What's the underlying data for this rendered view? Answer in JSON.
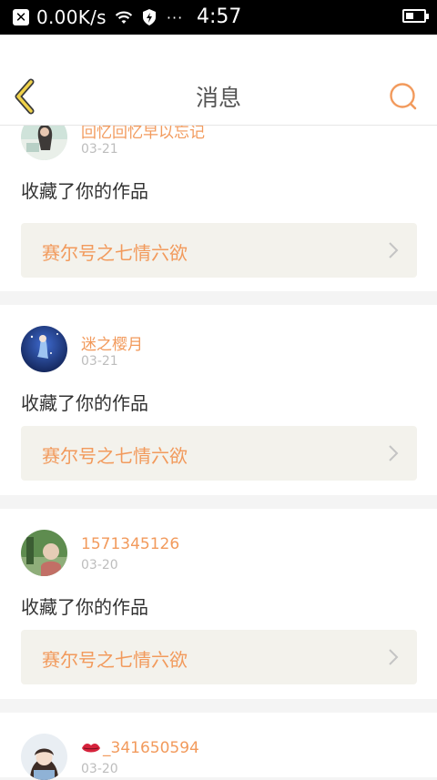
{
  "status_bar": {
    "speed": "0.00K/s",
    "time": "4:57",
    "dots": "···"
  },
  "header": {
    "title": "消息",
    "accent": "#f29a5c"
  },
  "messages": [
    {
      "username": "回忆回忆早以忘记",
      "date": "03-21",
      "action": "收藏了你的作品",
      "work_title": "赛尔号之七情六欲"
    },
    {
      "username": "迷之樱月",
      "date": "03-21",
      "action": "收藏了你的作品",
      "work_title": "赛尔号之七情六欲"
    },
    {
      "username": "1571345126",
      "date": "03-20",
      "action": "收藏了你的作品",
      "work_title": "赛尔号之七情六欲"
    },
    {
      "username": "_341650594",
      "date": "03-20"
    }
  ]
}
